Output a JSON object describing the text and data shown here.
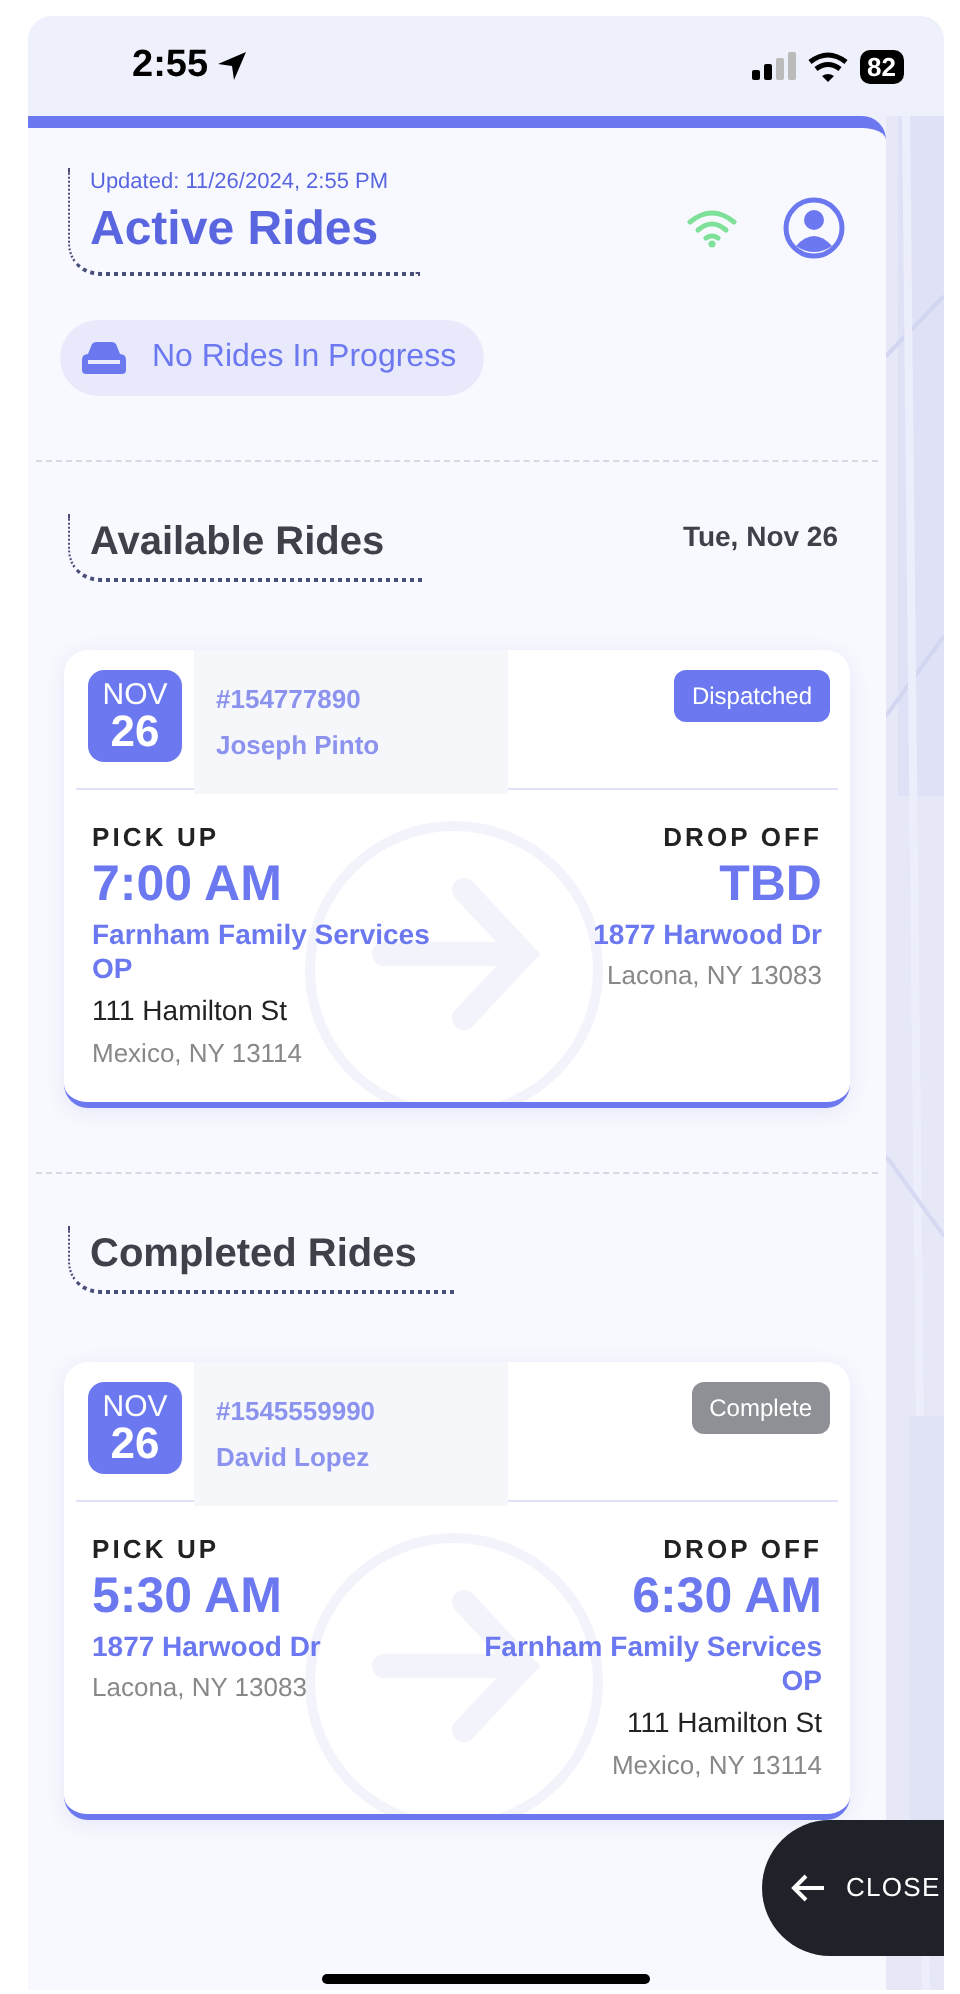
{
  "status_bar": {
    "time": "2:55",
    "battery": "82"
  },
  "header": {
    "updated": "Updated: 11/26/2024, 2:55 PM",
    "title": "Active Rides",
    "online": true
  },
  "active_status": "No Rides In Progress",
  "sections": [
    {
      "title": "Available Rides",
      "date": "Tue, Nov 26",
      "rides": [
        {
          "month": "NOV",
          "day": "26",
          "number": "#154777890",
          "name": "Joseph Pinto",
          "status": {
            "label": "Dispatched",
            "kind": "dispatched"
          },
          "pickup": {
            "label": "PICK UP",
            "time": "7:00 AM",
            "place": "Farnham Family Services OP",
            "street": "111 Hamilton St",
            "city": "Mexico, NY 13114"
          },
          "dropoff": {
            "label": "DROP OFF",
            "time": "TBD",
            "place": "1877 Harwood Dr",
            "city": "Lacona, NY 13083"
          }
        }
      ]
    },
    {
      "title": "Completed Rides",
      "rides": [
        {
          "month": "NOV",
          "day": "26",
          "number": "#1545559990",
          "name": "David Lopez",
          "status": {
            "label": "Complete",
            "kind": "complete"
          },
          "pickup": {
            "label": "PICK UP",
            "time": "5:30 AM",
            "place": "1877 Harwood Dr",
            "city": "Lacona, NY 13083"
          },
          "dropoff": {
            "label": "DROP OFF",
            "time": "6:30 AM",
            "place": "Farnham Family Services OP",
            "street": "111 Hamilton St",
            "city": "Mexico, NY 13114"
          }
        }
      ]
    }
  ],
  "close_button": "CLOSE"
}
